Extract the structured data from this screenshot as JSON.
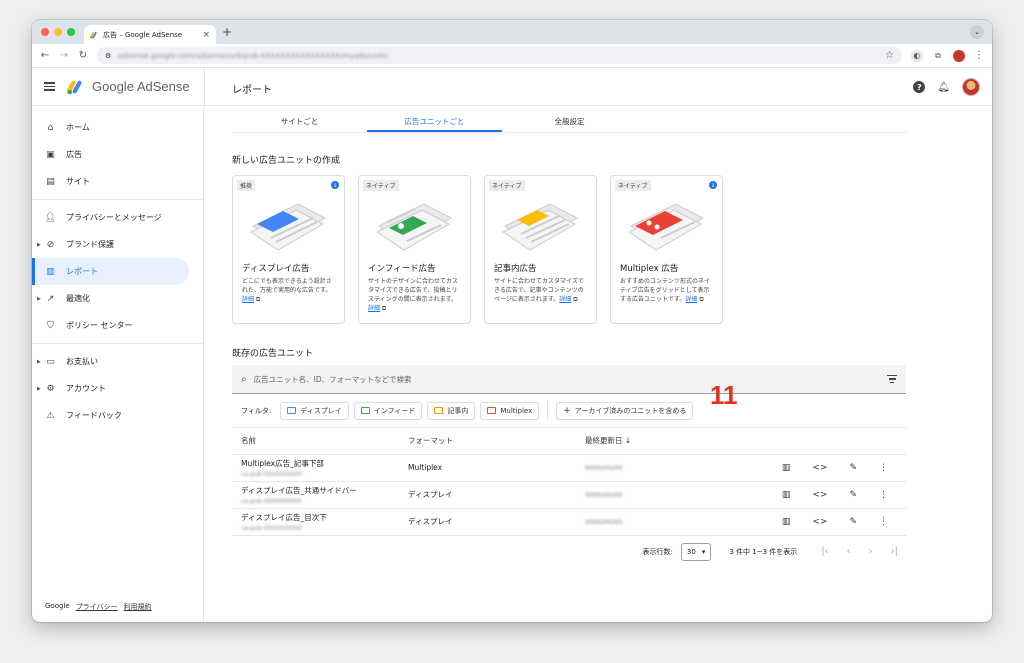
{
  "browser": {
    "tab_title": "広告 – Google AdSense",
    "url": "adsense.google.com/adsense/u/0/pub-XXXXXXXXXXXXXXXX/myads/units",
    "new_tab": "+",
    "tab_close": "×"
  },
  "header": {
    "logo_text": "Google AdSense",
    "page_title": "レポート",
    "help": "?"
  },
  "sidebar": {
    "items": [
      {
        "label": "ホーム",
        "icon": "home-icon"
      },
      {
        "label": "広告",
        "icon": "ads-icon"
      },
      {
        "label": "サイト",
        "icon": "sites-icon"
      },
      {
        "label": "プライバシーとメッセージ",
        "icon": "privacy-icon"
      },
      {
        "label": "ブランド保護",
        "icon": "block-icon"
      },
      {
        "label": "レポート",
        "icon": "report-icon"
      },
      {
        "label": "最適化",
        "icon": "trending-icon"
      },
      {
        "label": "ポリシー センター",
        "icon": "policy-icon"
      },
      {
        "label": "お支払い",
        "icon": "payment-icon"
      },
      {
        "label": "アカウント",
        "icon": "gear-icon"
      },
      {
        "label": "フィードバック",
        "icon": "feedback-icon"
      }
    ],
    "footer": {
      "google": "Google",
      "privacy": "プライバシー",
      "terms": "利用規約"
    }
  },
  "tabs": [
    "サイトごと",
    "広告ユニットごと",
    "全般設定"
  ],
  "create_section": {
    "title": "新しい広告ユニットの作成",
    "cards": [
      {
        "chip": "推奨",
        "title": "ディスプレイ広告",
        "desc": "どこにでも表示できるよう設計された、万能で実用的な広告です。",
        "more": "詳細",
        "accent": "#4285f4"
      },
      {
        "chip": "ネイティブ",
        "title": "インフィード広告",
        "desc": "サイトのデザインに合わせてカスタマイズできる広告で、投稿とリスティングの間に表示されます。",
        "more": "詳細",
        "accent": "#34a853"
      },
      {
        "chip": "ネイティブ",
        "title": "記事内広告",
        "desc": "サイトに合わせてカスタマイズできる広告で、記事やコンテンツのページに表示されます。",
        "more": "詳細",
        "accent": "#fbbc04"
      },
      {
        "chip": "ネイティブ",
        "title": "Multiplex 広告",
        "desc": "おすすめのコンテンツ形式のネイティブ広告をグリッドとして表示する広告ユニットです。",
        "more": "詳細",
        "accent": "#ea4335"
      }
    ]
  },
  "annotation": "11",
  "existing_section": {
    "title": "既存の広告ユニット",
    "search_placeholder": "広告ユニット名、ID、フォーマットなどで検索",
    "filter_label": "フィルタ:",
    "filters": [
      {
        "label": "ディスプレイ",
        "color": "#4285f4"
      },
      {
        "label": "インフィード",
        "color": "#34a853"
      },
      {
        "label": "記事内",
        "color": "#f29900"
      },
      {
        "label": "Multiplex",
        "color": "#ea4335"
      }
    ],
    "archive_label": "アーカイブ済みのユニットを含める",
    "columns": {
      "name": "名前",
      "format": "フォーマット",
      "updated": "最終更新日 ↓"
    },
    "rows": [
      {
        "name": "Multiplex広告_記事下部",
        "id": "ca-pub-0000000000",
        "format": "Multiplex",
        "updated": "0000/00/00"
      },
      {
        "name": "ディスプレイ広告_共通サイドバー",
        "id": "ca-pub-0000000000",
        "format": "ディスプレイ",
        "updated": "0000/00/00"
      },
      {
        "name": "ディスプレイ広告_目次下",
        "id": "ca-pub-0000000000",
        "format": "ディスプレイ",
        "updated": "0000/00/00"
      }
    ],
    "pager": {
      "rows_label": "表示行数:",
      "rows_value": "30",
      "range": "3 件中 1~3 件を表示"
    }
  }
}
